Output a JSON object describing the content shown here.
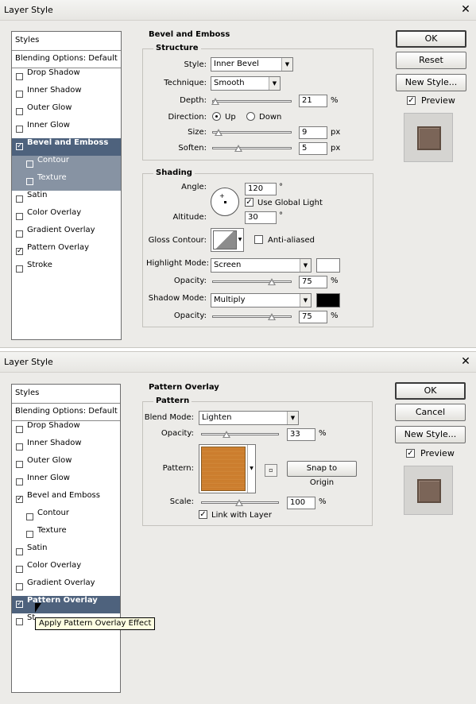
{
  "dialog1": {
    "title": "Layer Style",
    "styles_header": "Styles",
    "blending_options": "Blending Options: Default",
    "style_items": [
      {
        "label": "Drop Shadow",
        "checked": false
      },
      {
        "label": "Inner Shadow",
        "checked": false
      },
      {
        "label": "Outer Glow",
        "checked": false
      },
      {
        "label": "Inner Glow",
        "checked": false
      },
      {
        "label": "Bevel and Emboss",
        "checked": true
      },
      {
        "label": "Contour",
        "checked": false
      },
      {
        "label": "Texture",
        "checked": false
      },
      {
        "label": "Satin",
        "checked": false
      },
      {
        "label": "Color Overlay",
        "checked": false
      },
      {
        "label": "Gradient Overlay",
        "checked": false
      },
      {
        "label": "Pattern Overlay",
        "checked": true
      },
      {
        "label": "Stroke",
        "checked": false
      }
    ],
    "section_title": "Bevel and Emboss",
    "structure": {
      "title": "Structure",
      "style_label": "Style:",
      "style_value": "Inner Bevel",
      "technique_label": "Technique:",
      "technique_value": "Smooth",
      "depth_label": "Depth:",
      "depth_value": "21",
      "depth_unit": "%",
      "direction_label": "Direction:",
      "direction_up": "Up",
      "direction_down": "Down",
      "size_label": "Size:",
      "size_value": "9",
      "size_unit": "px",
      "soften_label": "Soften:",
      "soften_value": "5",
      "soften_unit": "px"
    },
    "shading": {
      "title": "Shading",
      "angle_label": "Angle:",
      "angle_value": "120",
      "angle_unit": "°",
      "global_light": "Use Global Light",
      "altitude_label": "Altitude:",
      "altitude_value": "30",
      "altitude_unit": "°",
      "gloss_label": "Gloss Contour:",
      "anti_aliased": "Anti-aliased",
      "highlight_label": "Highlight Mode:",
      "highlight_value": "Screen",
      "highlight_color": "#ffffff",
      "opacity1_label": "Opacity:",
      "opacity1_value": "75",
      "opacity1_unit": "%",
      "shadow_label": "Shadow Mode:",
      "shadow_value": "Multiply",
      "shadow_color": "#000000",
      "opacity2_label": "Opacity:",
      "opacity2_value": "75",
      "opacity2_unit": "%"
    },
    "buttons": {
      "ok": "OK",
      "reset": "Reset",
      "new_style": "New Style..."
    },
    "preview_label": "Preview"
  },
  "dialog2": {
    "title": "Layer Style",
    "styles_header": "Styles",
    "blending_options": "Blending Options: Default",
    "style_items": [
      {
        "label": "Drop Shadow",
        "checked": false
      },
      {
        "label": "Inner Shadow",
        "checked": false
      },
      {
        "label": "Outer Glow",
        "checked": false
      },
      {
        "label": "Inner Glow",
        "checked": false
      },
      {
        "label": "Bevel and Emboss",
        "checked": true
      },
      {
        "label": "Contour",
        "checked": false
      },
      {
        "label": "Texture",
        "checked": false
      },
      {
        "label": "Satin",
        "checked": false
      },
      {
        "label": "Color Overlay",
        "checked": false
      },
      {
        "label": "Gradient Overlay",
        "checked": false
      },
      {
        "label": "Pattern Overlay",
        "checked": true
      },
      {
        "label": "St",
        "checked": false
      }
    ],
    "section_title": "Pattern Overlay",
    "pattern": {
      "title": "Pattern",
      "blend_label": "Blend Mode:",
      "blend_value": "Lighten",
      "opacity_label": "Opacity:",
      "opacity_value": "33",
      "opacity_unit": "%",
      "pattern_label": "Pattern:",
      "snap_button": "Snap to Origin",
      "scale_label": "Scale:",
      "scale_value": "100",
      "scale_unit": "%",
      "link_label": "Link with Layer"
    },
    "buttons": {
      "ok": "OK",
      "cancel": "Cancel",
      "new_style": "New Style..."
    },
    "preview_label": "Preview",
    "tooltip": "Apply Pattern Overlay Effect"
  }
}
